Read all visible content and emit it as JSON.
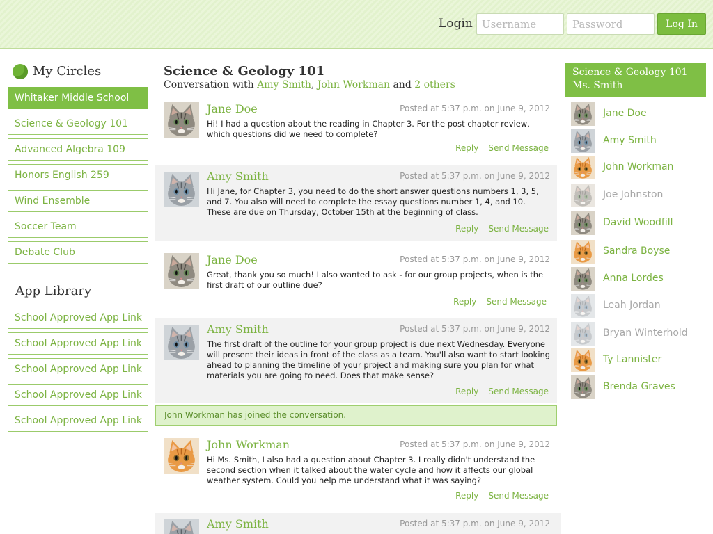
{
  "header": {
    "login_label": "Login",
    "username_placeholder": "Username",
    "password_placeholder": "Password",
    "login_button": "Log In",
    "colors": {
      "band": "#e6f4d3",
      "button": "#7cbd3f"
    }
  },
  "sidebar": {
    "circles_title": "My Circles",
    "circles": [
      {
        "label": "Whitaker Middle School",
        "active": true
      },
      {
        "label": "Science & Geology 101",
        "active": false
      },
      {
        "label": "Advanced Algebra 109",
        "active": false
      },
      {
        "label": "Honors English 259",
        "active": false
      },
      {
        "label": "Wind Ensemble",
        "active": false
      },
      {
        "label": "Soccer Team",
        "active": false
      },
      {
        "label": "Debate Club",
        "active": false
      }
    ],
    "app_library_title": "App Library",
    "apps": [
      {
        "label": "School Approved App Link"
      },
      {
        "label": "School Approved App Link"
      },
      {
        "label": "School Approved App Link"
      },
      {
        "label": "School Approved App Link"
      },
      {
        "label": "School Approved App Link"
      }
    ]
  },
  "conversation": {
    "title": "Science & Geology 101",
    "sub_prefix": "Conversation with",
    "participant_1": "Amy Smith",
    "participant_2": "John Workman",
    "and_word": "and",
    "others": "2 others",
    "reply_label": "Reply",
    "send_label": "Send Message",
    "messages": [
      {
        "author": "Jane Doe",
        "time": "Posted at 5:37 p.m. on June 9, 2012",
        "text": "Hi! I had a question about the reading in Chapter 3. For the post chapter review, which questions did we need to complete?",
        "avatar": "tabby-kitten-icon"
      },
      {
        "author": "Amy Smith",
        "time": "Posted at 5:37 p.m. on June 9, 2012",
        "text": "Hi Jane, for Chapter 3, you need to do the short answer questions numbers 1, 3, 5, and 7. You also will need to complete the essay questions number 1, 4, and 10. These are due on Thursday, October 15th at the beginning of class.",
        "avatar": "gray-kitten-icon"
      },
      {
        "author": "Jane Doe",
        "time": "Posted at 5:37 p.m. on June 9, 2012",
        "text": "Great, thank you so much! I also wanted to ask - for our group projects, when is the first draft of our outline due?",
        "avatar": "tabby-kitten-icon"
      },
      {
        "author": "Amy Smith",
        "time": "Posted at 5:37 p.m. on June 9, 2012",
        "text": "The first draft of the outline for your group project is due next Wednesday. Everyone will present their ideas in front of the class as a team. You'll also want to start looking ahead to planning the timeline of your project and making sure you plan for what materials you are going to need. Does that make sense?",
        "avatar": "gray-kitten-icon"
      },
      {
        "author": "John Workman",
        "time": "Posted at 5:37 p.m. on June 9, 2012",
        "text": "Hi Ms. Smith, I also had a question about Chapter 3. I really didn't understand the second section when it talked about the water cycle and how it affects our global weather system. Could you help me understand what it was saying?",
        "avatar": "orange-kitten-icon"
      },
      {
        "author": "Amy Smith",
        "time": "Posted at 5:37 p.m. on June 9, 2012",
        "text": "",
        "avatar": "gray-kitten-icon"
      }
    ],
    "notice": "John Workman has joined the conversation."
  },
  "members_panel": {
    "title_line1": "Science & Geology 101",
    "title_line2": "Ms. Smith",
    "members": [
      {
        "name": "Jane Doe",
        "online": true,
        "avatar": "tabby-kitten-icon"
      },
      {
        "name": "Amy Smith",
        "online": true,
        "avatar": "gray-kitten-icon"
      },
      {
        "name": "John Workman",
        "online": true,
        "avatar": "orange-kitten-icon"
      },
      {
        "name": "Joe Johnston",
        "online": false,
        "avatar": "tabby-kitten-icon"
      },
      {
        "name": "David Woodfill",
        "online": true,
        "avatar": "tabby-kitten-icon"
      },
      {
        "name": "Sandra Boyse",
        "online": true,
        "avatar": "orange-kitten-icon"
      },
      {
        "name": "Anna Lordes",
        "online": true,
        "avatar": "tabby-kitten-icon"
      },
      {
        "name": "Leah Jordan",
        "online": false,
        "avatar": "gray-kitten-icon"
      },
      {
        "name": "Bryan Winterhold",
        "online": false,
        "avatar": "gray-kitten-icon"
      },
      {
        "name": "Ty Lannister",
        "online": true,
        "avatar": "orange-kitten-icon"
      },
      {
        "name": "Brenda Graves",
        "online": true,
        "avatar": "tabby-kitten-icon"
      }
    ]
  }
}
